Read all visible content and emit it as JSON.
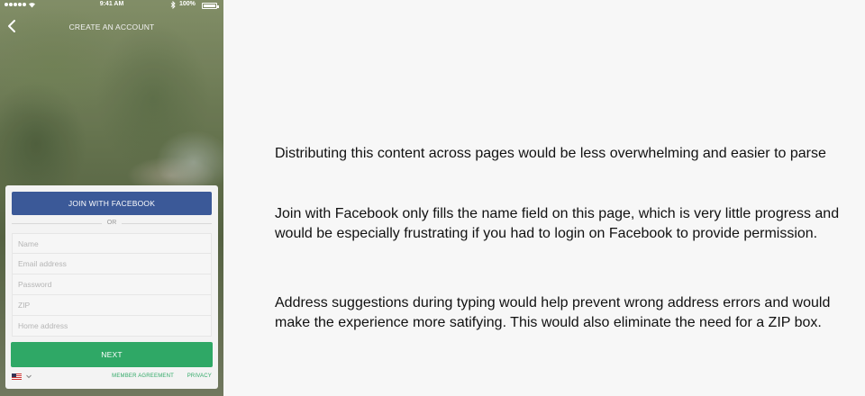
{
  "status_bar": {
    "time": "9:41 AM",
    "battery": "100%",
    "icons": [
      "signal-dots-icon",
      "wifi-icon",
      "bluetooth-icon",
      "battery-icon"
    ]
  },
  "nav": {
    "title": "CREATE AN ACCOUNT",
    "back_icon": "chevron-left-icon"
  },
  "form": {
    "facebook_button": "JOIN WITH FACEBOOK",
    "or_label": "OR",
    "fields": [
      {
        "placeholder": "Name",
        "value": ""
      },
      {
        "placeholder": "Email address",
        "value": ""
      },
      {
        "placeholder": "Password",
        "value": ""
      },
      {
        "placeholder": "ZIP",
        "value": ""
      },
      {
        "placeholder": "Home address",
        "value": ""
      }
    ],
    "next_button": "NEXT",
    "footer": {
      "flag_icon": "us-flag-icon",
      "member_agreement": "MEMBER AGREEMENT",
      "privacy": "PRIVACY"
    }
  },
  "colors": {
    "facebook": "#3b5998",
    "accent_green": "#2fa866"
  },
  "annotations": [
    "Distributing this content across pages would be less overwhelming and easier to parse",
    "Join with Facebook only fills the name field on this page, which is very little progress and would be especially frustrating if you had to login on Facebook to provide permission.",
    "Address suggestions during typing would help prevent wrong address errors and would make the experience more satifying. This would also eliminate the need for a ZIP box."
  ]
}
